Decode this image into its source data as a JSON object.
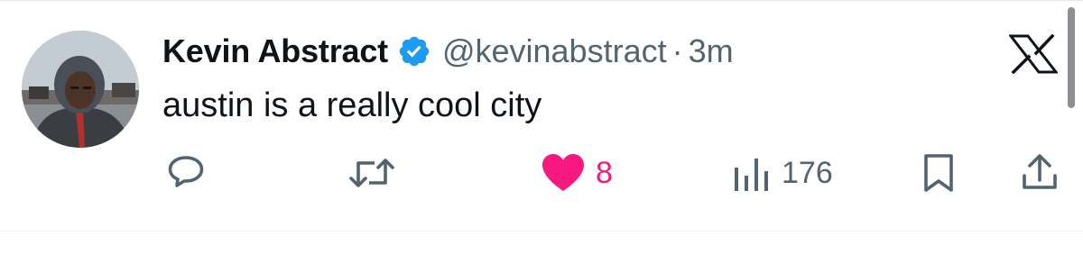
{
  "tweet": {
    "display_name": "Kevin Abstract",
    "handle": "@kevinabstract",
    "separator": "·",
    "time": "3m",
    "text": "austin is a really cool city",
    "verified": true
  },
  "icons": {
    "avatar": "profile-photo",
    "verified": "verified-badge-icon",
    "logo": "x-logo-icon",
    "reply": "reply-icon",
    "repost": "repost-icon",
    "like": "heart-filled-icon",
    "views": "views-bar-chart-icon",
    "bookmark": "bookmark-icon",
    "share": "share-icon"
  },
  "actions": {
    "likes": "8",
    "views": "176"
  },
  "colors": {
    "text": "#0f1419",
    "secondary": "#536471",
    "verified": "#1d9bf0",
    "like": "#f91880"
  }
}
